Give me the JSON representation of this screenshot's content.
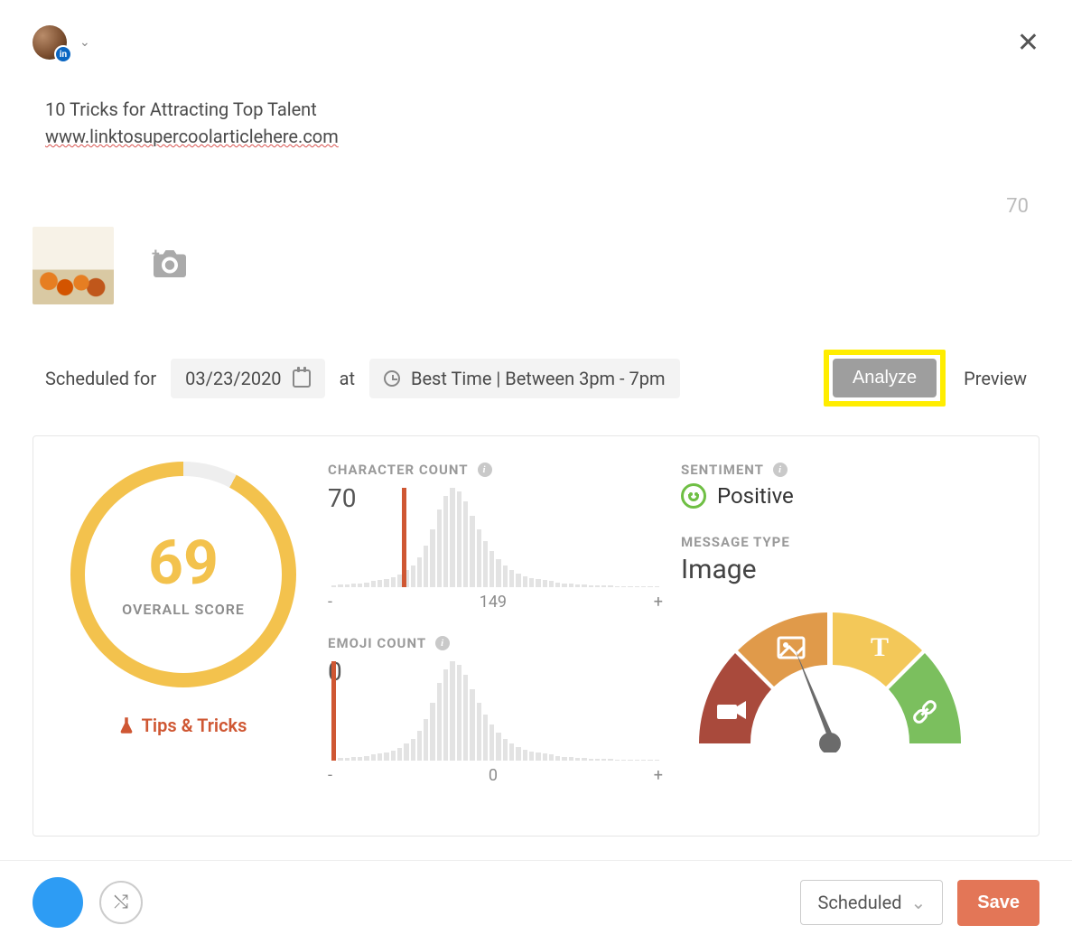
{
  "header": {
    "avatar_badge": "in"
  },
  "compose": {
    "text": "10 Tricks for Attracting Top Talent",
    "link": "www.linktosupercoolarticlehere.com",
    "char_count": "70"
  },
  "schedule": {
    "label": "Scheduled for",
    "date": "03/23/2020",
    "at": "at",
    "time_label": "Best Time | Between 3pm - 7pm",
    "analyze": "Analyze",
    "preview": "Preview"
  },
  "analysis": {
    "score": "69",
    "score_label": "OVERALL SCORE",
    "tips": "Tips & Tricks",
    "char_count": {
      "title": "CHARACTER COUNT",
      "value": "70",
      "min": "-",
      "mid": "149",
      "max": "+"
    },
    "emoji_count": {
      "title": "EMOJI COUNT",
      "value": "0",
      "min": "-",
      "mid": "0",
      "max": "+"
    },
    "sentiment": {
      "title": "SENTIMENT",
      "value": "Positive"
    },
    "message_type": {
      "title": "MESSAGE TYPE",
      "value": "Image"
    }
  },
  "footer": {
    "status": "Scheduled",
    "save": "Save"
  },
  "histogram_shape": [
    2,
    3,
    3,
    4,
    4,
    5,
    6,
    7,
    8,
    10,
    13,
    17,
    22,
    30,
    42,
    58,
    78,
    92,
    100,
    96,
    86,
    72,
    58,
    46,
    36,
    28,
    22,
    17,
    14,
    11,
    9,
    8,
    7,
    6,
    5,
    4,
    4,
    3,
    3,
    2,
    2,
    2,
    2,
    1,
    1,
    1,
    1,
    1,
    1,
    1
  ],
  "colors": {
    "accent_yellow": "#f3c24d",
    "accent_red": "#cf5733",
    "highlight": "#ffed00",
    "seg1": "#a94a3c",
    "seg2": "#e09a4a",
    "seg3": "#f3c24d",
    "seg4": "#7bbf5e"
  }
}
